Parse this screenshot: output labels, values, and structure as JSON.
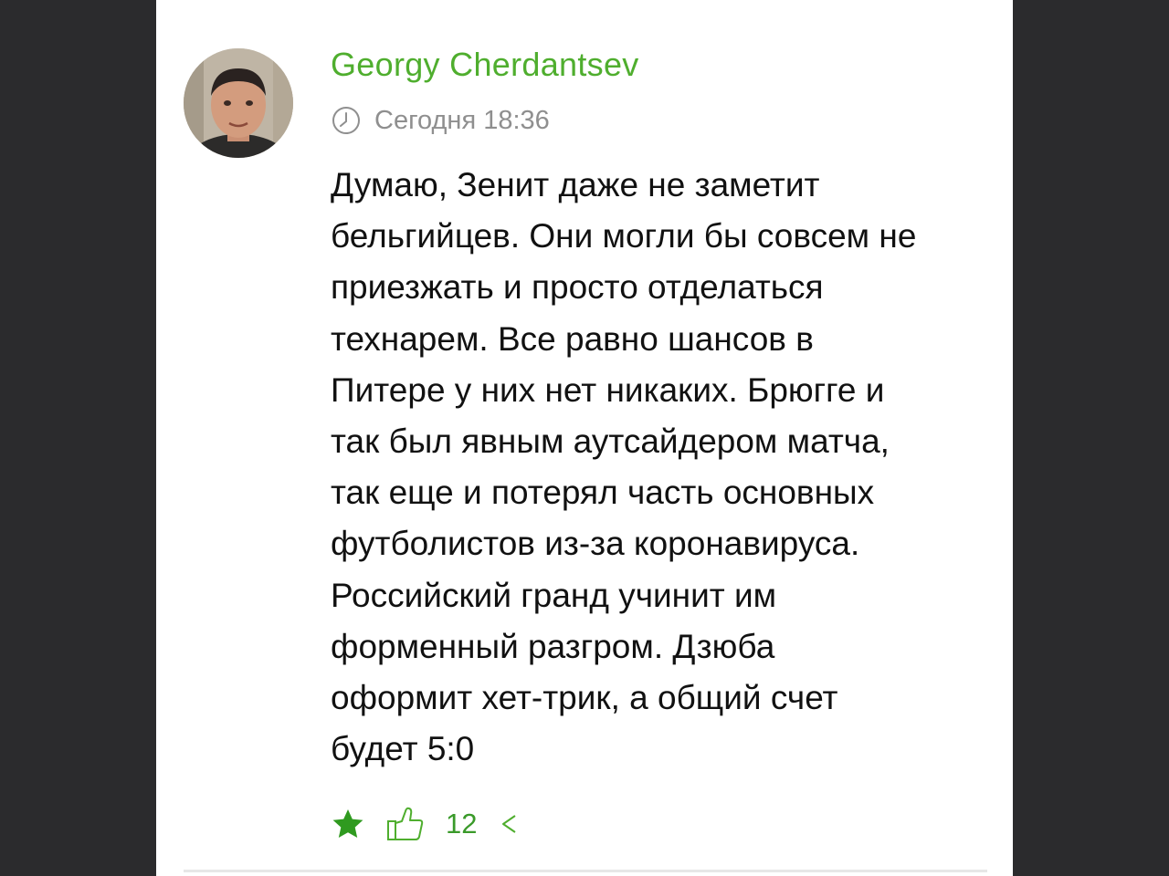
{
  "comment": {
    "author": "Georgy Cherdantsev",
    "timestamp": "Сегодня 18:36",
    "body_lines": [
      "Думаю, Зенит даже не заметит",
      "бельгийцев. Они могли бы совсем не",
      "приезжать и просто отделаться",
      "технарем. Все равно шансов в",
      "Питере у них нет никаких. Брюгге и",
      "так был явным аутсайдером матча,",
      "так еще и потерял часть основных",
      "футболистов из-за коронавируса.",
      "Российский гранд учинит им",
      "форменный разгром. Дзюба",
      "оформит хет-трик, а общий счет",
      "будет 5:0"
    ],
    "likes": "12"
  },
  "icons": {
    "clock": "clock-icon",
    "star": "star-icon",
    "like": "thumbs-up-icon",
    "share": "share-icon"
  },
  "colors": {
    "accent_green": "#4fae2e",
    "star_green": "#2f9a1f",
    "meta_gray": "#8f8f8f",
    "text": "#111111",
    "background": "#2b2b2d"
  }
}
